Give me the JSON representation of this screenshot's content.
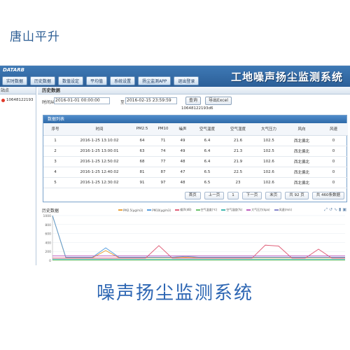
{
  "brand": "唐山平升",
  "topbar": {
    "logo": "DATARB",
    "nav": [
      "实时数据",
      "历史数据",
      "数值设定",
      "平均值",
      "系统设置",
      "扬尘监测APP",
      "退出登录"
    ],
    "system_title": "工地噪声扬尘监测系统"
  },
  "sidebar": {
    "header": "站点",
    "items": [
      "10648122193"
    ]
  },
  "main": {
    "panel_title": "历史数据",
    "filter": {
      "from_label": "时间从",
      "from_value": "2016-01-01 00:00:00",
      "to_label": "至",
      "to_value": "2016-02-15 23:59:59",
      "query_label": "查询",
      "export_label": "导出Excel",
      "device_id": "10648122193d6"
    },
    "table": {
      "title": "数据列表",
      "columns": [
        "序号",
        "时间",
        "PM2.5",
        "PM10",
        "噪声",
        "空气温度",
        "空气湿度",
        "大气压力",
        "风向",
        "风速"
      ],
      "rows": [
        [
          "1",
          "2016-1-25 13:10:02",
          "64",
          "71",
          "49",
          "6.4",
          "21.6",
          "102.5",
          "西北偏北",
          "0"
        ],
        [
          "2",
          "2016-1-25 13:00:01",
          "63",
          "74",
          "49",
          "6.4",
          "21.3",
          "102.5",
          "西北偏北",
          "0"
        ],
        [
          "3",
          "2016-1-25 12:50:02",
          "68",
          "77",
          "48",
          "6.4",
          "21.9",
          "102.6",
          "西北偏北",
          "0"
        ],
        [
          "4",
          "2016-1-25 12:40:02",
          "81",
          "87",
          "47",
          "6.5",
          "22.5",
          "102.6",
          "西北偏北",
          "0"
        ],
        [
          "5",
          "2016-1-25 12:30:02",
          "91",
          "97",
          "48",
          "6.5",
          "23",
          "102.6",
          "西北偏北",
          "0"
        ]
      ],
      "pager": {
        "first": "首页",
        "prev": "上一页",
        "page": "1",
        "next": "下一页",
        "last": "末页",
        "total_pages": "共 92 页",
        "total_records": "共 460条数据"
      }
    },
    "history": {
      "title": "历史数据",
      "legend": [
        {
          "label": "PM2.5(μg/m3)",
          "color": "#e9a23b"
        },
        {
          "label": "PM10(μg/m3)",
          "color": "#5aa0e0"
        },
        {
          "label": "噪声(dB)",
          "color": "#e0607a"
        },
        {
          "label": "空气温度(℃)",
          "color": "#6cc36c"
        },
        {
          "label": "空气湿度(%)",
          "color": "#40b8b0"
        },
        {
          "label": "大气压力(kpa)",
          "color": "#c060c0"
        },
        {
          "label": "风速(m/s)",
          "color": "#8888cc"
        }
      ],
      "y_ticks": [
        "1000",
        "800",
        "600",
        "400",
        "200",
        "0"
      ],
      "tool_icons": [
        "zoom-icon",
        "restore-icon",
        "line-icon",
        "bar-icon",
        "save-icon"
      ]
    }
  },
  "chart_data": {
    "type": "line",
    "title": "历史数据",
    "ylim": [
      0,
      1000
    ],
    "yticks": [
      0,
      200,
      400,
      600,
      800,
      1000
    ],
    "series": [
      {
        "name": "PM2.5(μg/m3)",
        "values": [
          1000,
          60,
          60,
          60,
          220,
          60,
          60,
          60,
          60,
          60,
          70,
          60,
          60,
          60,
          60,
          60,
          60,
          60,
          60,
          60,
          60,
          60,
          60
        ]
      },
      {
        "name": "PM10(μg/m3)",
        "values": [
          1000,
          70,
          70,
          70,
          280,
          70,
          70,
          70,
          70,
          70,
          90,
          70,
          70,
          70,
          70,
          70,
          70,
          70,
          70,
          70,
          70,
          70,
          70
        ]
      },
      {
        "name": "噪声(dB)",
        "values": [
          50,
          50,
          50,
          50,
          50,
          50,
          50,
          50,
          330,
          50,
          50,
          50,
          50,
          50,
          50,
          50,
          340,
          320,
          50,
          50,
          250,
          50,
          50
        ]
      },
      {
        "name": "空气温度(℃)",
        "values": [
          5,
          5,
          5,
          5,
          5,
          5,
          5,
          5,
          5,
          5,
          5,
          5,
          5,
          5,
          5,
          5,
          5,
          5,
          5,
          5,
          5,
          5,
          5
        ]
      },
      {
        "name": "空气湿度(%)",
        "values": [
          25,
          25,
          25,
          25,
          25,
          25,
          25,
          25,
          25,
          25,
          25,
          25,
          25,
          25,
          25,
          25,
          25,
          25,
          25,
          25,
          25,
          25,
          25
        ]
      },
      {
        "name": "大气压力(kpa)",
        "values": [
          100,
          100,
          100,
          100,
          100,
          100,
          100,
          100,
          100,
          100,
          100,
          100,
          100,
          100,
          100,
          100,
          100,
          100,
          100,
          100,
          100,
          100,
          100
        ]
      }
    ]
  },
  "caption": "噪声扬尘监测系统"
}
